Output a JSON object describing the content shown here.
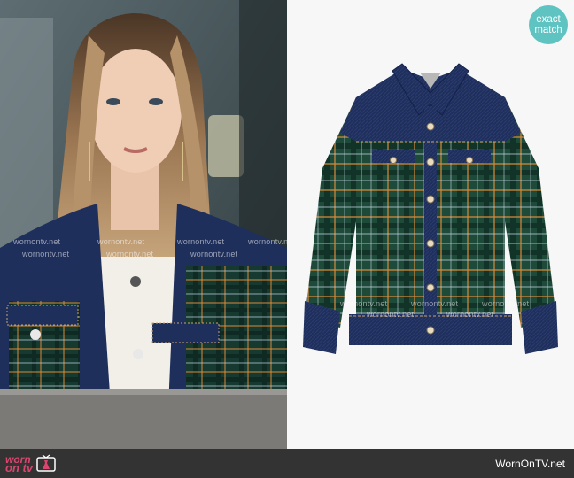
{
  "badge": {
    "line1": "exact",
    "line2": "match"
  },
  "watermark": {
    "text": "wornontv.net"
  },
  "footer": {
    "logo_line1": "worn",
    "logo_line2": "on tv",
    "site": "WornOnTV.net"
  },
  "colors": {
    "badge": "#5fc3c2",
    "footer_bg": "#333333",
    "logo_pink": "#d9456e",
    "denim": "#1f2f5c",
    "plaid_green": "#1e4a3a",
    "plaid_orange": "#d98a3a"
  }
}
